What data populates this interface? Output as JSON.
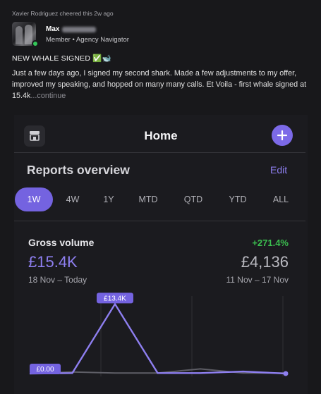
{
  "feed": {
    "activity": "Xavier Rodriguez cheered this 2w ago",
    "author": {
      "first_name": "Max",
      "subtitle": "Member • Agency Navigator"
    },
    "post": {
      "title": "NEW WHALE SIGNED ✅🐋",
      "body": "Just a few days ago, I signed my second shark. Made a few adjustments to my offer, improved my speaking, and hopped on many many calls. Et Voila - first whale signed at 15.4k",
      "continue_label": "...continue"
    }
  },
  "app": {
    "title": "Home",
    "icons": {
      "left": "store-icon",
      "right": "plus-icon"
    },
    "accent_color": "#7c6ae8",
    "reports": {
      "title": "Reports overview",
      "edit_label": "Edit",
      "tabs": [
        {
          "label": "1W",
          "active": true
        },
        {
          "label": "4W",
          "active": false
        },
        {
          "label": "1Y",
          "active": false
        },
        {
          "label": "MTD",
          "active": false
        },
        {
          "label": "QTD",
          "active": false
        },
        {
          "label": "YTD",
          "active": false
        },
        {
          "label": "ALL",
          "active": false
        }
      ]
    },
    "gross_volume": {
      "label": "Gross volume",
      "change": "+271.4%",
      "change_color": "#3bbf4f",
      "value": "£15.4K",
      "period": "18 Nov – Today",
      "previous_value": "£4,136",
      "previous_period": "11 Nov – 17 Nov"
    }
  },
  "chart_data": {
    "type": "line",
    "x": [
      1,
      2,
      3,
      4,
      5,
      6,
      7
    ],
    "series": [
      {
        "values": [
          0,
          0.1,
          13.4,
          0.1,
          0.1,
          0.4,
          0
        ],
        "color": "#8e7ff0"
      },
      {
        "values": [
          0,
          0.3,
          0.1,
          0.1,
          0.9,
          0.1,
          0.1
        ],
        "color": "#5e5e66"
      }
    ],
    "ylim": [
      0,
      14
    ],
    "max_label": "£13.4K",
    "min_label": "£0.00",
    "grid": true
  }
}
